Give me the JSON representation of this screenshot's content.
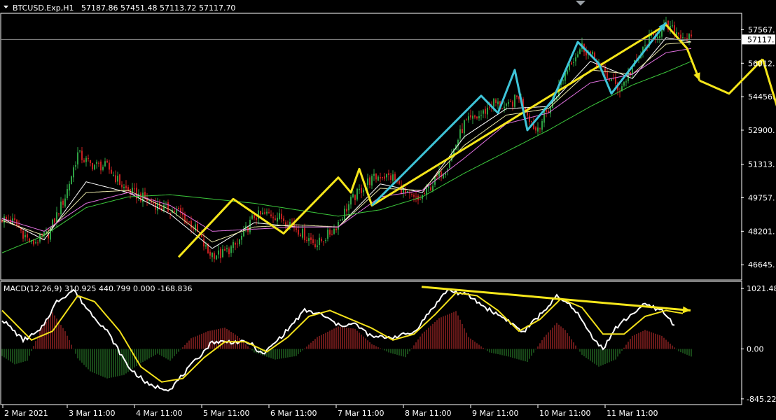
{
  "header": {
    "symbol": "BTCUSD.Exp,H1",
    "ohlc": "57187.86 57451.48 57113.72 57117.70",
    "macd": "MACD(12,26,9) 310.925 440.799 0.000 -168.836"
  },
  "colors": {
    "background": "#000000",
    "frame": "#ffffff",
    "bull": "#2ea043",
    "bear": "#c62020",
    "wick": "#bbbbbb",
    "ma_fast": "#ffffff",
    "ma_mid": "#e8e6a8",
    "ma_slow": "#e070e0",
    "ma_long": "#3cc83c",
    "annotation_yellow": "#f5e61a",
    "annotation_cyan": "#3ec4d8",
    "macd_line": "#ffffff",
    "signal_line": "#f2e01a",
    "hist_pos": "#d23232",
    "hist_neg": "#2f8f2f"
  },
  "chart_data": [
    {
      "type": "candlestick",
      "symbol": "BTCUSD.Exp",
      "timeframe": "H1",
      "last_price_label": "57117.",
      "ylim": [
        46000,
        58300
      ],
      "price_ticks": [
        "57567.",
        "56012.",
        "54456.",
        "52900.",
        "51313.",
        "49757.",
        "48201.",
        "46645."
      ],
      "price_tick_values": [
        57567,
        56012,
        54456,
        52900,
        51313,
        49757,
        48201,
        46645
      ],
      "time_labels": [
        "2 Mar 2021",
        "3 Mar 11:00",
        "4 Mar 11:00",
        "5 Mar 11:00",
        "6 Mar 11:00",
        "7 Mar 11:00",
        "8 Mar 11:00",
        "9 Mar 11:00",
        "10 Mar 11:00",
        "11 Mar 11:00"
      ],
      "close_path": [
        [
          0,
          48800
        ],
        [
          6,
          48600
        ],
        [
          14,
          47600
        ],
        [
          22,
          48100
        ],
        [
          30,
          49800
        ],
        [
          36,
          51800
        ],
        [
          42,
          51300
        ],
        [
          50,
          51200
        ],
        [
          58,
          50200
        ],
        [
          66,
          49800
        ],
        [
          76,
          49300
        ],
        [
          84,
          49100
        ],
        [
          92,
          48300
        ],
        [
          98,
          47200
        ],
        [
          104,
          47100
        ],
        [
          112,
          47600
        ],
        [
          120,
          48900
        ],
        [
          128,
          49000
        ],
        [
          136,
          48700
        ],
        [
          144,
          48000
        ],
        [
          150,
          47600
        ],
        [
          158,
          48300
        ],
        [
          166,
          49600
        ],
        [
          174,
          50500
        ],
        [
          180,
          50800
        ],
        [
          186,
          50700
        ],
        [
          192,
          49900
        ],
        [
          198,
          49600
        ],
        [
          204,
          50300
        ],
        [
          212,
          51300
        ],
        [
          220,
          53200
        ],
        [
          228,
          53600
        ],
        [
          234,
          54200
        ],
        [
          240,
          53900
        ],
        [
          246,
          54500
        ],
        [
          254,
          52900
        ],
        [
          262,
          54200
        ],
        [
          270,
          56000
        ],
        [
          276,
          56800
        ],
        [
          282,
          56200
        ],
        [
          288,
          55400
        ],
        [
          294,
          54800
        ],
        [
          302,
          56100
        ],
        [
          308,
          57100
        ],
        [
          316,
          57700
        ],
        [
          322,
          57400
        ],
        [
          328,
          57117
        ]
      ],
      "moving_averages": [
        {
          "color": "ma_fast",
          "points": [
            [
              0,
              48800
            ],
            [
              20,
              47800
            ],
            [
              40,
              50500
            ],
            [
              60,
              50000
            ],
            [
              80,
              49000
            ],
            [
              100,
              47400
            ],
            [
              120,
              48600
            ],
            [
              140,
              48400
            ],
            [
              160,
              48400
            ],
            [
              180,
              50400
            ],
            [
              200,
              50000
            ],
            [
              220,
              52600
            ],
            [
              240,
              53900
            ],
            [
              260,
              54000
            ],
            [
              280,
              56100
            ],
            [
              300,
              55300
            ],
            [
              316,
              57200
            ],
            [
              328,
              57000
            ]
          ]
        },
        {
          "color": "ma_mid",
          "points": [
            [
              0,
              48700
            ],
            [
              20,
              48000
            ],
            [
              40,
              50000
            ],
            [
              60,
              50100
            ],
            [
              80,
              49200
            ],
            [
              100,
              47700
            ],
            [
              120,
              48400
            ],
            [
              140,
              48500
            ],
            [
              160,
              48400
            ],
            [
              180,
              50200
            ],
            [
              200,
              50100
            ],
            [
              220,
              52200
            ],
            [
              240,
              53600
            ],
            [
              260,
              53900
            ],
            [
              280,
              55700
            ],
            [
              300,
              55500
            ],
            [
              316,
              56900
            ],
            [
              328,
              57000
            ]
          ]
        },
        {
          "color": "ma_slow",
          "points": [
            [
              0,
              48800
            ],
            [
              20,
              48200
            ],
            [
              40,
              49500
            ],
            [
              60,
              50000
            ],
            [
              80,
              49400
            ],
            [
              100,
              48200
            ],
            [
              120,
              48300
            ],
            [
              140,
              48400
            ],
            [
              160,
              48400
            ],
            [
              180,
              49800
            ],
            [
              200,
              50100
            ],
            [
              220,
              51600
            ],
            [
              240,
              53200
            ],
            [
              260,
              53700
            ],
            [
              280,
              55100
            ],
            [
              300,
              55500
            ],
            [
              316,
              56500
            ],
            [
              328,
              56700
            ]
          ]
        },
        {
          "color": "ma_long",
          "points": [
            [
              0,
              47200
            ],
            [
              20,
              48000
            ],
            [
              40,
              49300
            ],
            [
              60,
              49800
            ],
            [
              80,
              49900
            ],
            [
              100,
              49700
            ],
            [
              120,
              49500
            ],
            [
              140,
              49200
            ],
            [
              160,
              48900
            ],
            [
              180,
              49200
            ],
            [
              200,
              49800
            ],
            [
              220,
              50900
            ],
            [
              240,
              51900
            ],
            [
              260,
              52900
            ],
            [
              280,
              54000
            ],
            [
              300,
              55000
            ],
            [
              316,
              55600
            ],
            [
              328,
              56100
            ]
          ]
        }
      ],
      "annotations": [
        {
          "color": "annotation_yellow",
          "points": [
            [
              84,
              47000
            ],
            [
              110,
              49700
            ],
            [
              134,
              48100
            ],
            [
              160,
              50700
            ],
            [
              166,
              50000
            ],
            [
              170,
              51100
            ],
            [
              176,
              49400
            ],
            [
              316,
              57800
            ],
            [
              326,
              56700
            ],
            [
              332,
              55200
            ]
          ],
          "arrow": true
        },
        {
          "color": "annotation_yellow",
          "points": [
            [
              332,
              55200
            ],
            [
              346,
              54600
            ],
            [
              362,
              56200
            ]
          ],
          "arrow": true
        },
        {
          "color": "annotation_yellow",
          "points": [
            [
              362,
              56200
            ],
            [
              376,
              51700
            ]
          ],
          "arrow": true
        },
        {
          "color": "annotation_cyan",
          "points": [
            [
              176,
              49400
            ],
            [
              228,
              54500
            ],
            [
              236,
              53700
            ],
            [
              244,
              55700
            ],
            [
              250,
              52900
            ],
            [
              262,
              54300
            ],
            [
              274,
              57000
            ],
            [
              284,
              56000
            ],
            [
              290,
              54600
            ],
            [
              316,
              57900
            ]
          ],
          "arrow": true
        }
      ]
    },
    {
      "type": "bar",
      "name": "MACD(12,26,9)",
      "ylim": [
        -930,
        1130
      ],
      "ticks": [
        "1021.48",
        "0.00",
        "-845.22"
      ],
      "tick_values": [
        1021.48,
        0,
        -845.22
      ],
      "histogram": [
        [
          0,
          -120
        ],
        [
          6,
          -260
        ],
        [
          12,
          -200
        ],
        [
          18,
          300
        ],
        [
          24,
          620
        ],
        [
          30,
          300
        ],
        [
          36,
          -160
        ],
        [
          42,
          -380
        ],
        [
          50,
          -500
        ],
        [
          58,
          -440
        ],
        [
          66,
          -240
        ],
        [
          74,
          -80
        ],
        [
          80,
          -200
        ],
        [
          90,
          180
        ],
        [
          98,
          300
        ],
        [
          106,
          360
        ],
        [
          112,
          220
        ],
        [
          120,
          -60
        ],
        [
          130,
          -180
        ],
        [
          140,
          -120
        ],
        [
          150,
          200
        ],
        [
          160,
          380
        ],
        [
          168,
          340
        ],
        [
          176,
          80
        ],
        [
          184,
          -60
        ],
        [
          192,
          -140
        ],
        [
          200,
          260
        ],
        [
          208,
          520
        ],
        [
          216,
          640
        ],
        [
          222,
          200
        ],
        [
          232,
          -60
        ],
        [
          240,
          -120
        ],
        [
          250,
          -220
        ],
        [
          258,
          200
        ],
        [
          264,
          440
        ],
        [
          268,
          320
        ],
        [
          276,
          -100
        ],
        [
          284,
          -300
        ],
        [
          292,
          -180
        ],
        [
          300,
          220
        ],
        [
          306,
          320
        ],
        [
          314,
          220
        ],
        [
          322,
          -40
        ],
        [
          328,
          -130
        ]
      ],
      "series": [
        {
          "key": "macd_line",
          "points": [
            [
              0,
              500
            ],
            [
              10,
              150
            ],
            [
              18,
              300
            ],
            [
              26,
              800
            ],
            [
              34,
              1000
            ],
            [
              40,
              700
            ],
            [
              50,
              300
            ],
            [
              60,
              -300
            ],
            [
              70,
              -620
            ],
            [
              80,
              -680
            ],
            [
              90,
              -280
            ],
            [
              100,
              120
            ],
            [
              110,
              120
            ],
            [
              118,
              100
            ],
            [
              124,
              -100
            ],
            [
              134,
              250
            ],
            [
              144,
              650
            ],
            [
              152,
              580
            ],
            [
              160,
              400
            ],
            [
              168,
              420
            ],
            [
              176,
              200
            ],
            [
              186,
              200
            ],
            [
              196,
              280
            ],
            [
              204,
              650
            ],
            [
              212,
              1000
            ],
            [
              222,
              900
            ],
            [
              230,
              700
            ],
            [
              240,
              500
            ],
            [
              248,
              280
            ],
            [
              258,
              650
            ],
            [
              264,
              880
            ],
            [
              272,
              700
            ],
            [
              280,
              250
            ],
            [
              286,
              0
            ],
            [
              292,
              350
            ],
            [
              300,
              600
            ],
            [
              306,
              750
            ],
            [
              314,
              650
            ],
            [
              320,
              400
            ]
          ]
        },
        {
          "key": "signal_line",
          "points": [
            [
              0,
              650
            ],
            [
              14,
              150
            ],
            [
              24,
              300
            ],
            [
              36,
              900
            ],
            [
              44,
              800
            ],
            [
              56,
              300
            ],
            [
              66,
              -300
            ],
            [
              76,
              -560
            ],
            [
              86,
              -500
            ],
            [
              96,
              -150
            ],
            [
              106,
              120
            ],
            [
              116,
              120
            ],
            [
              126,
              -50
            ],
            [
              136,
              200
            ],
            [
              146,
              550
            ],
            [
              156,
              650
            ],
            [
              166,
              500
            ],
            [
              176,
              350
            ],
            [
              186,
              150
            ],
            [
              196,
              250
            ],
            [
              206,
              580
            ],
            [
              216,
              950
            ],
            [
              226,
              900
            ],
            [
              236,
              650
            ],
            [
              246,
              300
            ],
            [
              256,
              500
            ],
            [
              266,
              850
            ],
            [
              276,
              700
            ],
            [
              286,
              250
            ],
            [
              296,
              250
            ],
            [
              306,
              550
            ],
            [
              316,
              650
            ],
            [
              324,
              600
            ]
          ]
        }
      ],
      "trend_arrow": [
        [
          200,
          1050
        ],
        [
          328,
          650
        ]
      ]
    }
  ]
}
